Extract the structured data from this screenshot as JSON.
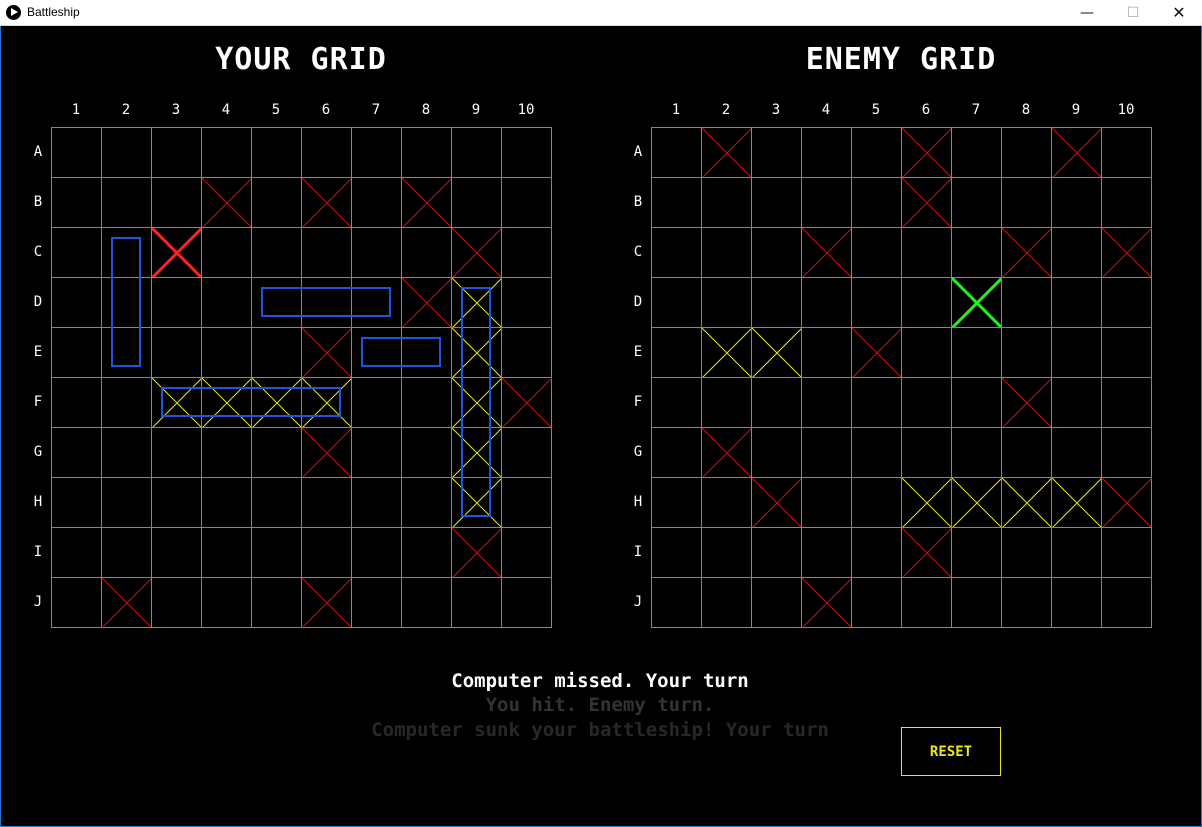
{
  "window": {
    "title": "Battleship",
    "minimize": "—",
    "maximize": "☐",
    "close": "✕"
  },
  "colors": {
    "grid": "#18d418",
    "miss": "#cc1010",
    "last_miss": "#ff2020",
    "hit": "#e8e81a",
    "last_hit": "#22ee22",
    "ship": "#1d55e0",
    "reset": "#e8e81a"
  },
  "columns": [
    "1",
    "2",
    "3",
    "4",
    "5",
    "6",
    "7",
    "8",
    "9",
    "10"
  ],
  "rows": [
    "A",
    "B",
    "C",
    "D",
    "E",
    "F",
    "G",
    "H",
    "I",
    "J"
  ],
  "player": {
    "title": "YOUR GRID",
    "ships": [
      {
        "row": "C",
        "col": 2,
        "length": 3,
        "orientation": "vertical"
      },
      {
        "row": "D",
        "col": 5,
        "length": 3,
        "orientation": "horizontal"
      },
      {
        "row": "E",
        "col": 7,
        "length": 2,
        "orientation": "horizontal"
      },
      {
        "row": "F",
        "col": 3,
        "length": 4,
        "orientation": "horizontal"
      },
      {
        "row": "D",
        "col": 9,
        "length": 5,
        "orientation": "vertical"
      }
    ],
    "marks": [
      {
        "row": "B",
        "col": 4,
        "type": "miss"
      },
      {
        "row": "B",
        "col": 6,
        "type": "miss"
      },
      {
        "row": "B",
        "col": 8,
        "type": "miss"
      },
      {
        "row": "C",
        "col": 3,
        "type": "last_miss"
      },
      {
        "row": "C",
        "col": 9,
        "type": "miss"
      },
      {
        "row": "D",
        "col": 8,
        "type": "miss"
      },
      {
        "row": "D",
        "col": 9,
        "type": "hit"
      },
      {
        "row": "E",
        "col": 6,
        "type": "miss"
      },
      {
        "row": "E",
        "col": 9,
        "type": "hit"
      },
      {
        "row": "F",
        "col": 3,
        "type": "hit"
      },
      {
        "row": "F",
        "col": 4,
        "type": "hit"
      },
      {
        "row": "F",
        "col": 5,
        "type": "hit"
      },
      {
        "row": "F",
        "col": 6,
        "type": "hit"
      },
      {
        "row": "F",
        "col": 9,
        "type": "hit"
      },
      {
        "row": "F",
        "col": 10,
        "type": "miss"
      },
      {
        "row": "G",
        "col": 6,
        "type": "miss"
      },
      {
        "row": "G",
        "col": 9,
        "type": "hit"
      },
      {
        "row": "H",
        "col": 9,
        "type": "hit"
      },
      {
        "row": "I",
        "col": 9,
        "type": "miss"
      },
      {
        "row": "J",
        "col": 2,
        "type": "miss"
      },
      {
        "row": "J",
        "col": 6,
        "type": "miss"
      }
    ]
  },
  "enemy": {
    "title": "ENEMY GRID",
    "marks": [
      {
        "row": "A",
        "col": 2,
        "type": "miss"
      },
      {
        "row": "A",
        "col": 6,
        "type": "miss"
      },
      {
        "row": "A",
        "col": 9,
        "type": "miss"
      },
      {
        "row": "B",
        "col": 6,
        "type": "miss"
      },
      {
        "row": "C",
        "col": 4,
        "type": "miss"
      },
      {
        "row": "C",
        "col": 8,
        "type": "miss"
      },
      {
        "row": "C",
        "col": 10,
        "type": "miss"
      },
      {
        "row": "D",
        "col": 7,
        "type": "last_hit"
      },
      {
        "row": "E",
        "col": 2,
        "type": "hit"
      },
      {
        "row": "E",
        "col": 3,
        "type": "hit"
      },
      {
        "row": "E",
        "col": 5,
        "type": "miss"
      },
      {
        "row": "F",
        "col": 8,
        "type": "miss"
      },
      {
        "row": "G",
        "col": 2,
        "type": "miss"
      },
      {
        "row": "H",
        "col": 3,
        "type": "miss"
      },
      {
        "row": "H",
        "col": 6,
        "type": "hit"
      },
      {
        "row": "H",
        "col": 7,
        "type": "hit"
      },
      {
        "row": "H",
        "col": 8,
        "type": "hit"
      },
      {
        "row": "H",
        "col": 9,
        "type": "hit"
      },
      {
        "row": "H",
        "col": 10,
        "type": "miss"
      },
      {
        "row": "I",
        "col": 6,
        "type": "miss"
      },
      {
        "row": "J",
        "col": 4,
        "type": "miss"
      }
    ]
  },
  "messages": [
    "Computer missed. Your turn",
    "You hit. Enemy turn.",
    "Computer sunk your battleship! Your turn"
  ],
  "reset_label": "RESET"
}
